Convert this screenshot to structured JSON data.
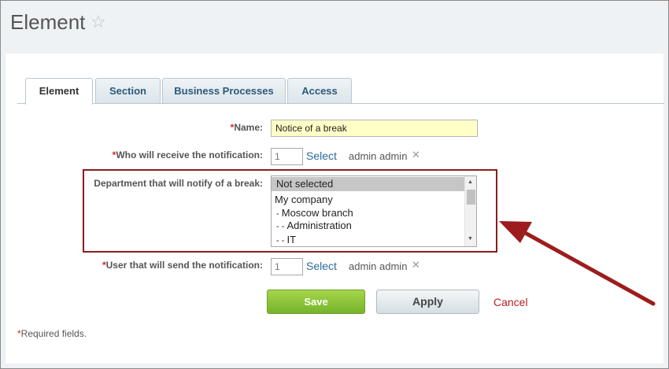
{
  "page": {
    "title": "Element",
    "favorite_icon": "star-outline-icon"
  },
  "tabs": [
    {
      "label": "Element",
      "active": true
    },
    {
      "label": "Section",
      "active": false
    },
    {
      "label": "Business Processes",
      "active": false
    },
    {
      "label": "Access",
      "active": false
    }
  ],
  "form": {
    "required_mark": "*",
    "name": {
      "label": "Name:",
      "value": "Notice of a break"
    },
    "receiver": {
      "label": "Who will receive the notification:",
      "id_value": "1",
      "select_label": "Select",
      "user": "admin admin",
      "remove_icon": "close-icon"
    },
    "department": {
      "label": "Department that will notify of a break:",
      "options": [
        {
          "label": "Not selected",
          "prefix": ""
        },
        {
          "label": "My company",
          "prefix": ""
        },
        {
          "label": "Moscow branch",
          "prefix": "- "
        },
        {
          "label": "Administration",
          "prefix": "- - "
        },
        {
          "label": "IT",
          "prefix": "- - "
        }
      ],
      "selected_index": 0
    },
    "sender": {
      "label": "User that will send the notification:",
      "id_value": "1",
      "select_label": "Select",
      "user": "admin admin",
      "remove_icon": "close-icon"
    }
  },
  "actions": {
    "save": "Save",
    "apply": "Apply",
    "cancel": "Cancel"
  },
  "footer": {
    "required_note": "Required fields."
  },
  "colors": {
    "highlight": "#8b1c1c",
    "save_green": "#75b42a",
    "cancel_red": "#b32222",
    "link_blue": "#2c6b9a"
  }
}
